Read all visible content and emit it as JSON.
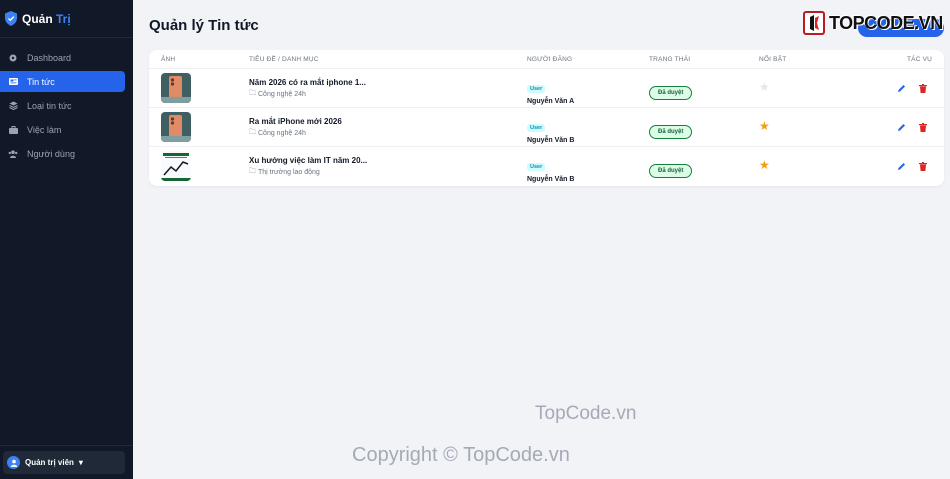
{
  "sidebar": {
    "brand_main": "Quản",
    "brand_accent": "Trị",
    "items": [
      {
        "label": "Dashboard",
        "icon": "dashboard-icon"
      },
      {
        "label": "Tin tức",
        "icon": "news-icon",
        "active": true
      },
      {
        "label": "Loại tin tức",
        "icon": "layers-icon"
      },
      {
        "label": "Việc làm",
        "icon": "briefcase-icon"
      },
      {
        "label": "Người dùng",
        "icon": "users-icon"
      }
    ],
    "user_label": "Quản trị viên"
  },
  "header": {
    "title": "Quản lý Tin tức",
    "logo_text": "TOPCODE.VN"
  },
  "table": {
    "columns": [
      "Ảnh",
      "Tiêu đề / Danh mục",
      "Người đăng",
      "Trạng thái",
      "Nổi bật",
      "Tác vụ"
    ],
    "rows": [
      {
        "title": "Năm 2026 có ra mắt iphone 1...",
        "category": "Công nghệ 24h",
        "role": "User",
        "author": "Nguyễn Văn A",
        "status": "Đã duyệt",
        "featured": false,
        "thumb": "phone"
      },
      {
        "title": "Ra mắt iPhone mới 2026",
        "category": "Công nghệ 24h",
        "role": "User",
        "author": "Nguyễn Văn B",
        "status": "Đã duyệt",
        "featured": true,
        "thumb": "phone"
      },
      {
        "title": "Xu hướng việc làm IT năm 20...",
        "category": "Thị trường lao động",
        "role": "User",
        "author": "Nguyễn Văn B",
        "status": "Đã duyệt",
        "featured": true,
        "thumb": "chart"
      }
    ]
  },
  "watermarks": {
    "top": "TopCode.vn",
    "bottom": "Copyright © TopCode.vn"
  },
  "colors": {
    "sidebar_bg": "#111827",
    "accent": "#2563eb",
    "star": "#f59e0b",
    "delete": "#dc2626"
  }
}
